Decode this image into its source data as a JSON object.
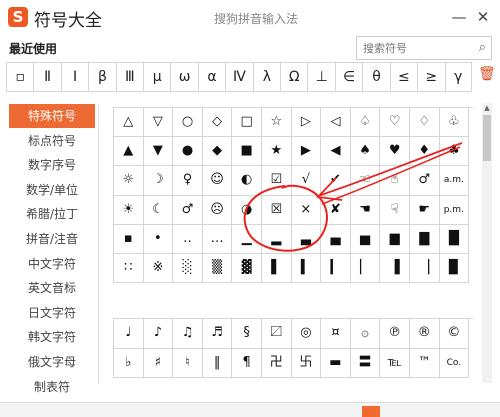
{
  "app": {
    "logo_letter": "S",
    "title": "符号大全",
    "window_title": "搜狗拼音输入法",
    "minimize": "—",
    "close": "✕"
  },
  "recent": {
    "label": "最近使用",
    "symbols": [
      "▫",
      "Ⅱ",
      "Ⅰ",
      "β",
      "Ⅲ",
      "μ",
      "ω",
      "α",
      "Ⅳ",
      "λ",
      "Ω",
      "⊥",
      "∈",
      "θ",
      "≤",
      "≥",
      "γ"
    ],
    "trash_icon": "trash-icon"
  },
  "search": {
    "placeholder": "搜索符号",
    "icon": "search-icon"
  },
  "sidebar": {
    "items": [
      {
        "label": "特殊符号",
        "active": true
      },
      {
        "label": "标点符号",
        "active": false
      },
      {
        "label": "数字序号",
        "active": false
      },
      {
        "label": "数学/单位",
        "active": false
      },
      {
        "label": "希腊/拉丁",
        "active": false
      },
      {
        "label": "拼音/注音",
        "active": false
      },
      {
        "label": "中文字符",
        "active": false
      },
      {
        "label": "英文音标",
        "active": false
      },
      {
        "label": "日文字符",
        "active": false
      },
      {
        "label": "韩文字符",
        "active": false
      },
      {
        "label": "俄文字母",
        "active": false
      },
      {
        "label": "制表符",
        "active": false
      }
    ]
  },
  "grid1": [
    [
      "△",
      "▽",
      "○",
      "◇",
      "□",
      "☆",
      "▷",
      "◁",
      "♤",
      "♡",
      "♢",
      "♧"
    ],
    [
      "▲",
      "▼",
      "●",
      "◆",
      "■",
      "★",
      "▶",
      "◀",
      "♠",
      "♥",
      "♦",
      "♣"
    ],
    [
      "☼",
      "☽",
      "♀",
      "☺",
      "◐",
      "☑",
      "√",
      "✔",
      "☜",
      "☝",
      "♂",
      "a.m."
    ],
    [
      "☀",
      "☾",
      "♂",
      "☹",
      "◑",
      "☒",
      "×",
      "✘",
      "☚",
      "☟",
      "☛",
      "p.m."
    ],
    [
      "▪",
      "•",
      "‥",
      "…",
      "▁",
      "▂",
      "▃",
      "▄",
      "▅",
      "▆",
      "▇",
      "█"
    ],
    [
      "∷",
      "※",
      "░",
      "▒",
      "▓",
      "▌",
      "▍",
      "▎",
      "▏",
      "▐",
      "▕",
      "▉"
    ]
  ],
  "grid2": [
    [
      "♩",
      "♪",
      "♫",
      "♬",
      "§",
      "〼",
      "◎",
      "¤",
      "۞",
      "℗",
      "®",
      "©"
    ],
    [
      "♭",
      "♯",
      "♮",
      "‖",
      "¶",
      "卍",
      "卐",
      "▬",
      "〓",
      "℡",
      "™",
      "Co."
    ]
  ],
  "colors": {
    "accent": "#ee6a34",
    "annotation": "#e8231f"
  }
}
